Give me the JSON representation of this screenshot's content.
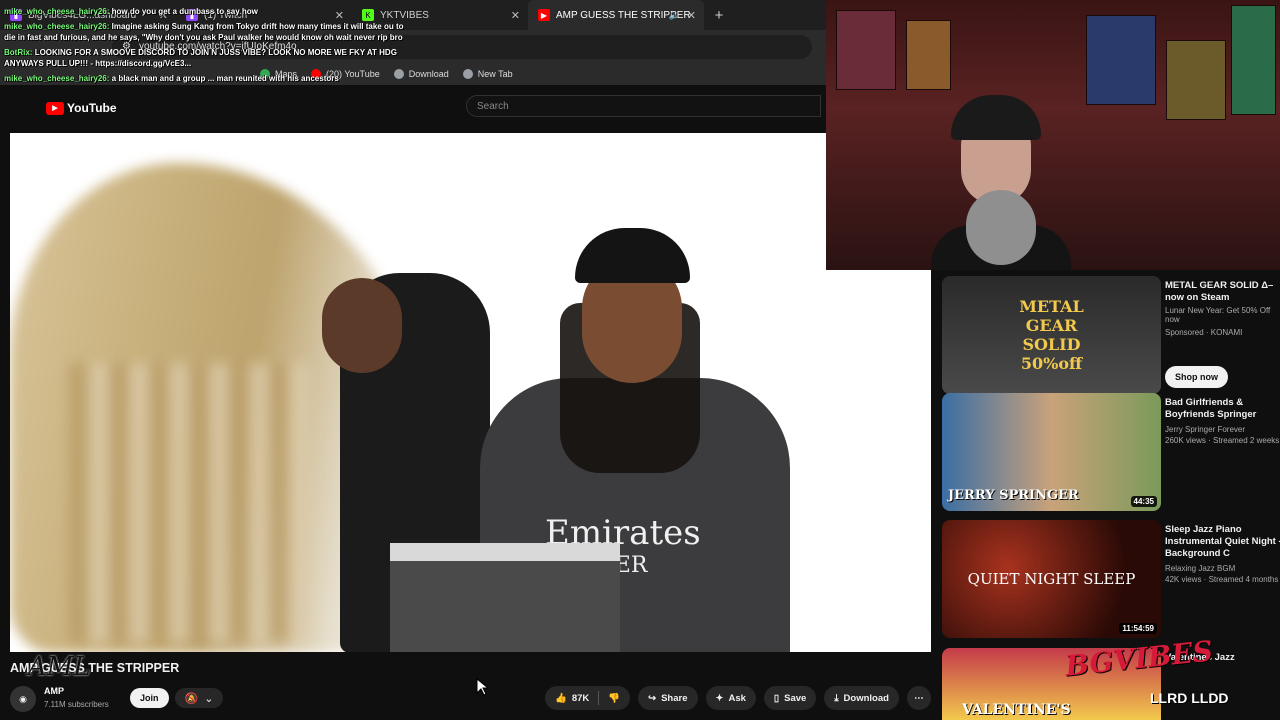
{
  "tabs": [
    {
      "label": "BigVibes4LG...ashboard",
      "icon": "twitch-icon",
      "active": false
    },
    {
      "label": "(1) Twitch",
      "icon": "twitch-icon",
      "active": false
    },
    {
      "label": "YKTVIBES",
      "icon": "kick-icon",
      "active": false
    },
    {
      "label": "AMP GUESS THE STRIPPER",
      "icon": "youtube-icon",
      "active": true
    }
  ],
  "address": {
    "url": "youtube.com/watch?v=jfUIoKefm4o"
  },
  "bookmarks": [
    {
      "label": "Maps",
      "icon": "maps-icon"
    },
    {
      "label": "(20) YouTube",
      "icon": "youtube-icon"
    },
    {
      "label": "Download",
      "icon": "download-icon"
    },
    {
      "label": "New Tab",
      "icon": "globe-icon"
    }
  ],
  "youtube": {
    "logo": "YouTube",
    "search_placeholder": "Search"
  },
  "chat": [
    {
      "user": "mike_who_cheese_hairy26:",
      "text": "how do you get a dumbass to say how"
    },
    {
      "user": "mike_who_cheese_hairy26:",
      "text": "Imagine asking Sung Kang from Tokyo drift how many times it will take ou to die in fast and furious, and he says, \"Why don't you ask Paul walker he would know oh wait never rip bro"
    },
    {
      "user": "BotRix:",
      "text": "LOOKING FOR A SMOOVE DISCORD TO JOIN N JUSS VIBE? LOOK NO MORE WE FKY AT HDG ANYWAYS PULL UP!!! - https://discord.gg/VcE3..."
    },
    {
      "user": "mike_who_cheese_hairy26:",
      "text": "a black man and a group ... man reunited with his ancestors"
    }
  ],
  "video": {
    "jersey_text_1": "Emirates",
    "jersey_text_2": "TTER",
    "title": "AMP GUESS THE STRIPPER",
    "channel_name": "AMP",
    "subscribers": "7.11M subscribers",
    "join_label": "Join",
    "likes": "87K",
    "share_label": "Share",
    "ask_label": "Ask",
    "save_label": "Save",
    "download_label": "Download"
  },
  "recommendations": [
    {
      "title": "METAL GEAR SOLID Δ– now on Steam",
      "channel": "Sponsored · KONAMI",
      "stats": "Lunar New Year: Get 50% Off now",
      "thumb_text": "METAL GEAR SOLID  50%off",
      "cta": "Shop now",
      "duration": ""
    },
    {
      "title": "Bad Girlfriends & Boyfriends Springer",
      "channel": "Jerry Springer Forever",
      "stats": "260K views · Streamed 2 weeks",
      "thumb_text": "JERRY SPRINGER",
      "cta": "",
      "duration": "44:35"
    },
    {
      "title": "Sleep Jazz Piano Instrumental Quiet Night - Background C",
      "channel": "Relaxing Jazz BGM",
      "stats": "42K views · Streamed 4 months",
      "thumb_text": "QUIET NIGHT SLEEP",
      "cta": "",
      "duration": "11:54:59"
    },
    {
      "title": "Valentines Jazz",
      "channel": "",
      "stats": "",
      "thumb_text": "VALENTINE'S",
      "cta": "",
      "duration": ""
    }
  ],
  "overlay": {
    "watermark": "BGVIBES",
    "handles": "LLRD LLDD"
  },
  "colors": {
    "accent": "#ff0000",
    "background": "#0f0f0f",
    "chat_user": "#7cfc7c"
  }
}
